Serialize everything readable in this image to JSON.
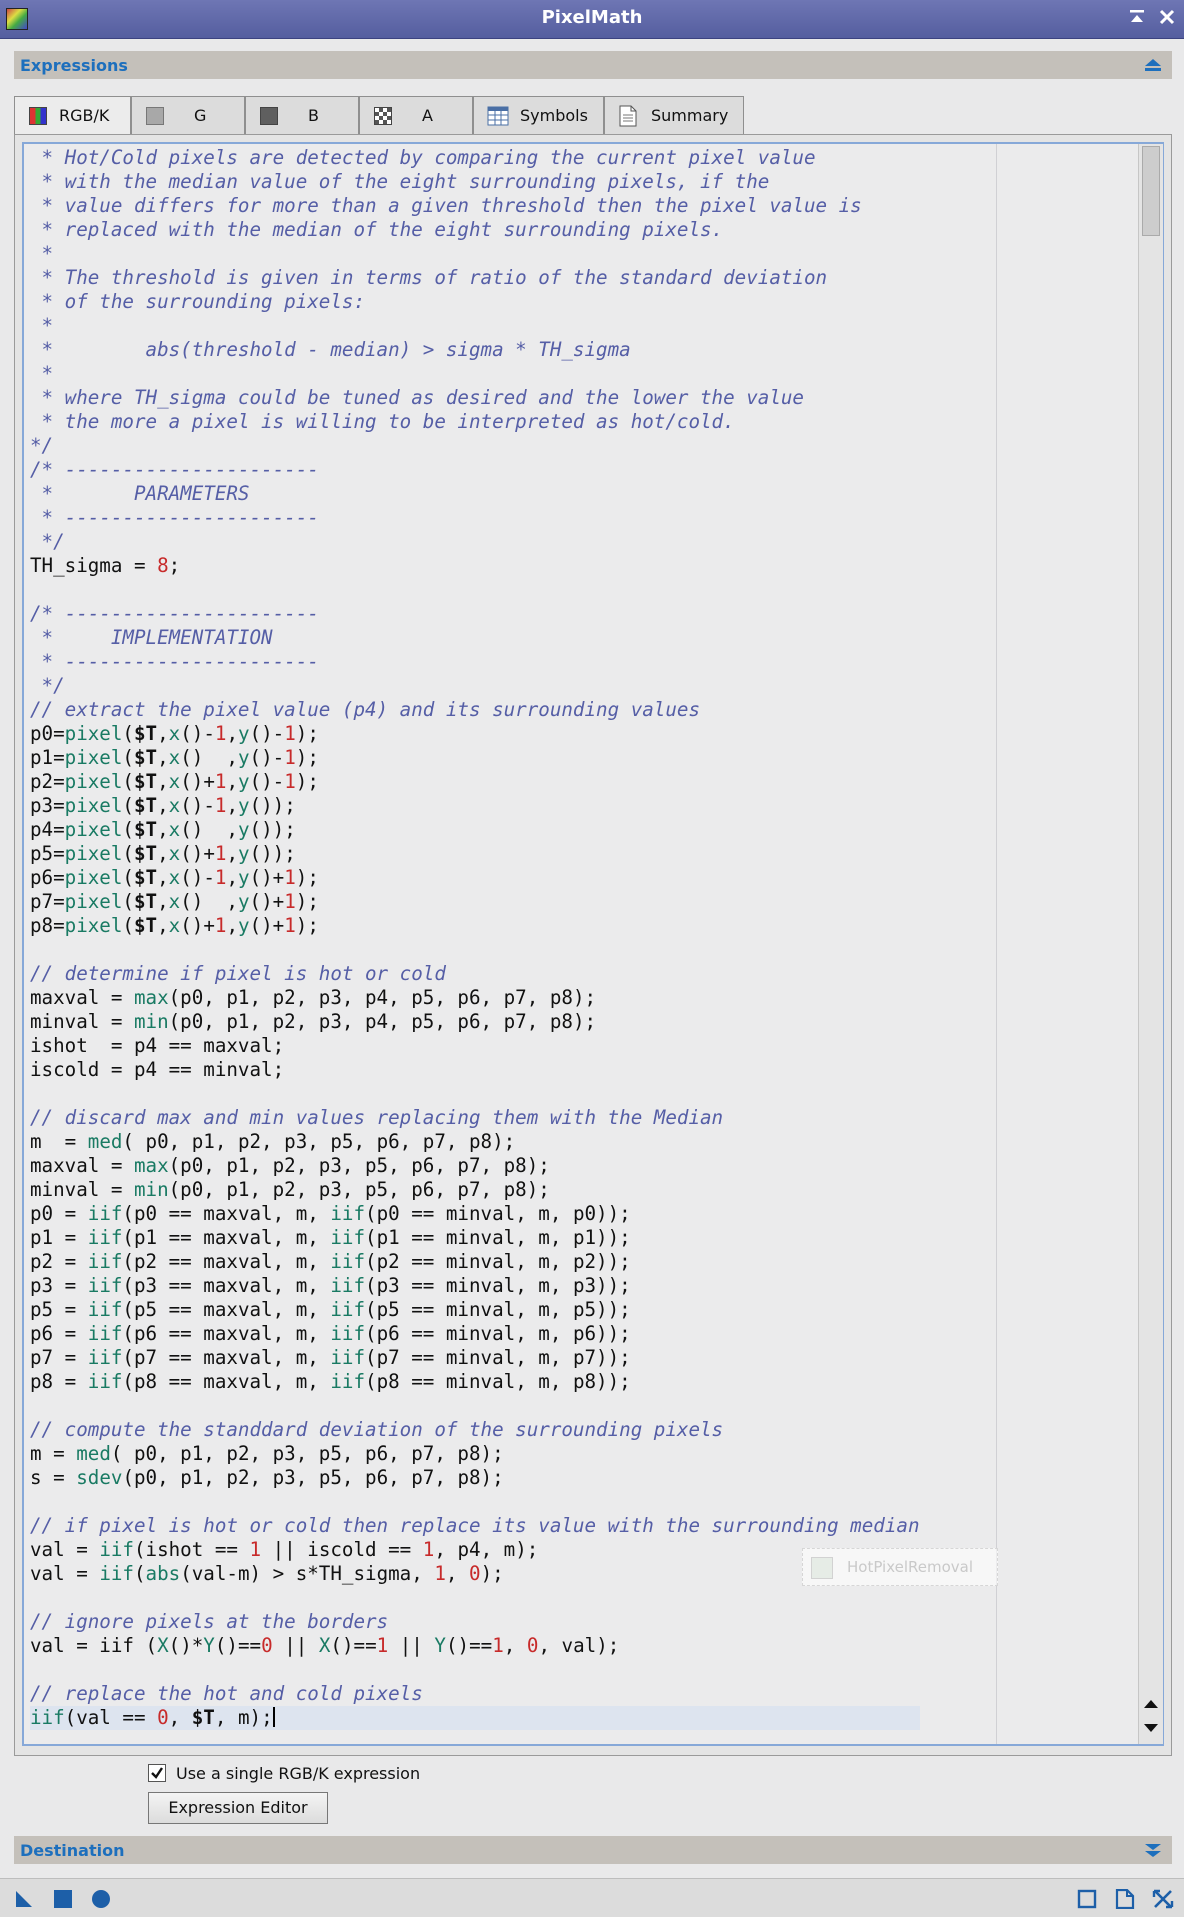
{
  "window": {
    "title": "PixelMath"
  },
  "sections": {
    "expressions": "Expressions",
    "destination": "Destination"
  },
  "tabs": [
    {
      "label": "RGB/K",
      "icon": "rgb-channel-icon",
      "active": true
    },
    {
      "label": "G",
      "icon": "gray-square-icon"
    },
    {
      "label": "B",
      "icon": "dark-square-icon"
    },
    {
      "label": "A",
      "icon": "checker-icon"
    },
    {
      "label": "Symbols",
      "icon": "table-icon"
    },
    {
      "label": "Summary",
      "icon": "document-icon"
    }
  ],
  "code_colors": {
    "comment": "#555ea6",
    "function": "#197a63",
    "number": "#c72a2a"
  },
  "code_lines": [
    [
      [
        "c",
        " * Hot/Cold pixels are detected by comparing the current pixel value"
      ]
    ],
    [
      [
        "c",
        " * with the median value of the eight surrounding pixels, if the"
      ]
    ],
    [
      [
        "c",
        " * value differs for more than a given threshold then the pixel value is"
      ]
    ],
    [
      [
        "c",
        " * replaced with the median of the eight surrounding pixels."
      ]
    ],
    [
      [
        "c",
        " *"
      ]
    ],
    [
      [
        "c",
        " * The threshold is given in terms of ratio of the standard deviation"
      ]
    ],
    [
      [
        "c",
        " * of the surrounding pixels:"
      ]
    ],
    [
      [
        "c",
        " *"
      ]
    ],
    [
      [
        "c",
        " *        abs(threshold - median) > sigma * TH_sigma"
      ]
    ],
    [
      [
        "c",
        " *"
      ]
    ],
    [
      [
        "c",
        " * where TH_sigma could be tuned as desired and the lower the value"
      ]
    ],
    [
      [
        "c",
        " * the more a pixel is willing to be interpreted as hot/cold."
      ]
    ],
    [
      [
        "c",
        "*/"
      ]
    ],
    [
      [
        "c",
        "/* ----------------------"
      ]
    ],
    [
      [
        "c",
        " *       PARAMETERS"
      ]
    ],
    [
      [
        "c",
        " * ----------------------"
      ]
    ],
    [
      [
        "c",
        " */"
      ]
    ],
    [
      [
        "t",
        "TH_sigma = "
      ],
      [
        "n",
        "8"
      ],
      [
        "t",
        ";"
      ]
    ],
    [
      [
        "t",
        ""
      ]
    ],
    [
      [
        "c",
        "/* ----------------------"
      ]
    ],
    [
      [
        "c",
        " *     IMPLEMENTATION"
      ]
    ],
    [
      [
        "c",
        " * ----------------------"
      ]
    ],
    [
      [
        "c",
        " */"
      ]
    ],
    [
      [
        "c",
        "// extract the pixel value (p4) and its surrounding values "
      ]
    ],
    [
      [
        "t",
        "p0="
      ],
      [
        "f",
        "pixel"
      ],
      [
        "t",
        "("
      ],
      [
        "k",
        "$T"
      ],
      [
        "t",
        ","
      ],
      [
        "f",
        "x"
      ],
      [
        "t",
        "()-"
      ],
      [
        "n",
        "1"
      ],
      [
        "t",
        ","
      ],
      [
        "f",
        "y"
      ],
      [
        "t",
        "()-"
      ],
      [
        "n",
        "1"
      ],
      [
        "t",
        ");"
      ]
    ],
    [
      [
        "t",
        "p1="
      ],
      [
        "f",
        "pixel"
      ],
      [
        "t",
        "("
      ],
      [
        "k",
        "$T"
      ],
      [
        "t",
        ","
      ],
      [
        "f",
        "x"
      ],
      [
        "t",
        "()  ,"
      ],
      [
        "f",
        "y"
      ],
      [
        "t",
        "()-"
      ],
      [
        "n",
        "1"
      ],
      [
        "t",
        ");"
      ]
    ],
    [
      [
        "t",
        "p2="
      ],
      [
        "f",
        "pixel"
      ],
      [
        "t",
        "("
      ],
      [
        "k",
        "$T"
      ],
      [
        "t",
        ","
      ],
      [
        "f",
        "x"
      ],
      [
        "t",
        "()+"
      ],
      [
        "n",
        "1"
      ],
      [
        "t",
        ","
      ],
      [
        "f",
        "y"
      ],
      [
        "t",
        "()-"
      ],
      [
        "n",
        "1"
      ],
      [
        "t",
        ");"
      ]
    ],
    [
      [
        "t",
        "p3="
      ],
      [
        "f",
        "pixel"
      ],
      [
        "t",
        "("
      ],
      [
        "k",
        "$T"
      ],
      [
        "t",
        ","
      ],
      [
        "f",
        "x"
      ],
      [
        "t",
        "()-"
      ],
      [
        "n",
        "1"
      ],
      [
        "t",
        ","
      ],
      [
        "f",
        "y"
      ],
      [
        "t",
        "());"
      ]
    ],
    [
      [
        "t",
        "p4="
      ],
      [
        "f",
        "pixel"
      ],
      [
        "t",
        "("
      ],
      [
        "k",
        "$T"
      ],
      [
        "t",
        ","
      ],
      [
        "f",
        "x"
      ],
      [
        "t",
        "()  ,"
      ],
      [
        "f",
        "y"
      ],
      [
        "t",
        "());"
      ]
    ],
    [
      [
        "t",
        "p5="
      ],
      [
        "f",
        "pixel"
      ],
      [
        "t",
        "("
      ],
      [
        "k",
        "$T"
      ],
      [
        "t",
        ","
      ],
      [
        "f",
        "x"
      ],
      [
        "t",
        "()+"
      ],
      [
        "n",
        "1"
      ],
      [
        "t",
        ","
      ],
      [
        "f",
        "y"
      ],
      [
        "t",
        "());"
      ]
    ],
    [
      [
        "t",
        "p6="
      ],
      [
        "f",
        "pixel"
      ],
      [
        "t",
        "("
      ],
      [
        "k",
        "$T"
      ],
      [
        "t",
        ","
      ],
      [
        "f",
        "x"
      ],
      [
        "t",
        "()-"
      ],
      [
        "n",
        "1"
      ],
      [
        "t",
        ","
      ],
      [
        "f",
        "y"
      ],
      [
        "t",
        "()+"
      ],
      [
        "n",
        "1"
      ],
      [
        "t",
        ");"
      ]
    ],
    [
      [
        "t",
        "p7="
      ],
      [
        "f",
        "pixel"
      ],
      [
        "t",
        "("
      ],
      [
        "k",
        "$T"
      ],
      [
        "t",
        ","
      ],
      [
        "f",
        "x"
      ],
      [
        "t",
        "()  ,"
      ],
      [
        "f",
        "y"
      ],
      [
        "t",
        "()+"
      ],
      [
        "n",
        "1"
      ],
      [
        "t",
        ");"
      ]
    ],
    [
      [
        "t",
        "p8="
      ],
      [
        "f",
        "pixel"
      ],
      [
        "t",
        "("
      ],
      [
        "k",
        "$T"
      ],
      [
        "t",
        ","
      ],
      [
        "f",
        "x"
      ],
      [
        "t",
        "()+"
      ],
      [
        "n",
        "1"
      ],
      [
        "t",
        ","
      ],
      [
        "f",
        "y"
      ],
      [
        "t",
        "()+"
      ],
      [
        "n",
        "1"
      ],
      [
        "t",
        ");"
      ]
    ],
    [
      [
        "t",
        ""
      ]
    ],
    [
      [
        "c",
        "// determine if pixel is hot or cold"
      ]
    ],
    [
      [
        "t",
        "maxval = "
      ],
      [
        "f",
        "max"
      ],
      [
        "t",
        "(p0, p1, p2, p3, p4, p5, p6, p7, p8);"
      ]
    ],
    [
      [
        "t",
        "minval = "
      ],
      [
        "f",
        "min"
      ],
      [
        "t",
        "(p0, p1, p2, p3, p4, p5, p6, p7, p8);"
      ]
    ],
    [
      [
        "t",
        "ishot  = p4 == maxval;"
      ]
    ],
    [
      [
        "t",
        "iscold = p4 == minval;"
      ]
    ],
    [
      [
        "t",
        ""
      ]
    ],
    [
      [
        "c",
        "// discard max and min values replacing them with the Median"
      ]
    ],
    [
      [
        "t",
        "m  = "
      ],
      [
        "f",
        "med"
      ],
      [
        "t",
        "( p0, p1, p2, p3, p5, p6, p7, p8);"
      ]
    ],
    [
      [
        "t",
        "maxval = "
      ],
      [
        "f",
        "max"
      ],
      [
        "t",
        "(p0, p1, p2, p3, p5, p6, p7, p8);"
      ]
    ],
    [
      [
        "t",
        "minval = "
      ],
      [
        "f",
        "min"
      ],
      [
        "t",
        "(p0, p1, p2, p3, p5, p6, p7, p8);"
      ]
    ],
    [
      [
        "t",
        "p0 = "
      ],
      [
        "f",
        "iif"
      ],
      [
        "t",
        "(p0 == maxval, m, "
      ],
      [
        "f",
        "iif"
      ],
      [
        "t",
        "(p0 == minval, m, p0));"
      ]
    ],
    [
      [
        "t",
        "p1 = "
      ],
      [
        "f",
        "iif"
      ],
      [
        "t",
        "(p1 == maxval, m, "
      ],
      [
        "f",
        "iif"
      ],
      [
        "t",
        "(p1 == minval, m, p1));"
      ]
    ],
    [
      [
        "t",
        "p2 = "
      ],
      [
        "f",
        "iif"
      ],
      [
        "t",
        "(p2 == maxval, m, "
      ],
      [
        "f",
        "iif"
      ],
      [
        "t",
        "(p2 == minval, m, p2));"
      ]
    ],
    [
      [
        "t",
        "p3 = "
      ],
      [
        "f",
        "iif"
      ],
      [
        "t",
        "(p3 == maxval, m, "
      ],
      [
        "f",
        "iif"
      ],
      [
        "t",
        "(p3 == minval, m, p3));"
      ]
    ],
    [
      [
        "t",
        "p5 = "
      ],
      [
        "f",
        "iif"
      ],
      [
        "t",
        "(p5 == maxval, m, "
      ],
      [
        "f",
        "iif"
      ],
      [
        "t",
        "(p5 == minval, m, p5));"
      ]
    ],
    [
      [
        "t",
        "p6 = "
      ],
      [
        "f",
        "iif"
      ],
      [
        "t",
        "(p6 == maxval, m, "
      ],
      [
        "f",
        "iif"
      ],
      [
        "t",
        "(p6 == minval, m, p6));"
      ]
    ],
    [
      [
        "t",
        "p7 = "
      ],
      [
        "f",
        "iif"
      ],
      [
        "t",
        "(p7 == maxval, m, "
      ],
      [
        "f",
        "iif"
      ],
      [
        "t",
        "(p7 == minval, m, p7));"
      ]
    ],
    [
      [
        "t",
        "p8 = "
      ],
      [
        "f",
        "iif"
      ],
      [
        "t",
        "(p8 == maxval, m, "
      ],
      [
        "f",
        "iif"
      ],
      [
        "t",
        "(p8 == minval, m, p8));"
      ]
    ],
    [
      [
        "t",
        ""
      ]
    ],
    [
      [
        "c",
        "// compute the standdard deviation of the surrounding pixels"
      ]
    ],
    [
      [
        "t",
        "m = "
      ],
      [
        "f",
        "med"
      ],
      [
        "t",
        "( p0, p1, p2, p3, p5, p6, p7, p8);"
      ]
    ],
    [
      [
        "t",
        "s = "
      ],
      [
        "f",
        "sdev"
      ],
      [
        "t",
        "(p0, p1, p2, p3, p5, p6, p7, p8);"
      ]
    ],
    [
      [
        "t",
        ""
      ]
    ],
    [
      [
        "c",
        "// if pixel is hot or cold then replace its value with the surrounding median"
      ]
    ],
    [
      [
        "t",
        "val = "
      ],
      [
        "f",
        "iif"
      ],
      [
        "t",
        "(ishot == "
      ],
      [
        "n",
        "1"
      ],
      [
        "t",
        " || iscold == "
      ],
      [
        "n",
        "1"
      ],
      [
        "t",
        ", p4, m);"
      ]
    ],
    [
      [
        "t",
        "val = "
      ],
      [
        "f",
        "iif"
      ],
      [
        "t",
        "("
      ],
      [
        "f",
        "abs"
      ],
      [
        "t",
        "(val-m) > s*TH_sigma, "
      ],
      [
        "n",
        "1"
      ],
      [
        "t",
        ", "
      ],
      [
        "n",
        "0"
      ],
      [
        "t",
        ");"
      ]
    ],
    [
      [
        "t",
        ""
      ]
    ],
    [
      [
        "c",
        "// ignore pixels at the borders"
      ]
    ],
    [
      [
        "t",
        "val = iif ("
      ],
      [
        "f",
        "X"
      ],
      [
        "t",
        "()*"
      ],
      [
        "f",
        "Y"
      ],
      [
        "t",
        "()=="
      ],
      [
        "n",
        "0"
      ],
      [
        "t",
        " || "
      ],
      [
        "f",
        "X"
      ],
      [
        "t",
        "()=="
      ],
      [
        "n",
        "1"
      ],
      [
        "t",
        " || "
      ],
      [
        "f",
        "Y"
      ],
      [
        "t",
        "()=="
      ],
      [
        "n",
        "1"
      ],
      [
        "t",
        ", "
      ],
      [
        "n",
        "0"
      ],
      [
        "t",
        ", val);"
      ]
    ],
    [
      [
        "t",
        ""
      ]
    ],
    [
      [
        "c",
        "// replace the hot and cold pixels"
      ]
    ],
    [
      [
        "f",
        "iif"
      ],
      [
        "t",
        "(val == "
      ],
      [
        "n",
        "0"
      ],
      [
        "t",
        ", "
      ],
      [
        "k",
        "$T"
      ],
      [
        "t",
        ", m);"
      ]
    ]
  ],
  "drag_ghost": {
    "label": "HotPixelRemoval"
  },
  "options": {
    "single_expression_label": "Use a single RGB/K expression",
    "single_expression_checked": true
  },
  "buttons": {
    "expression_editor": "Expression Editor"
  }
}
